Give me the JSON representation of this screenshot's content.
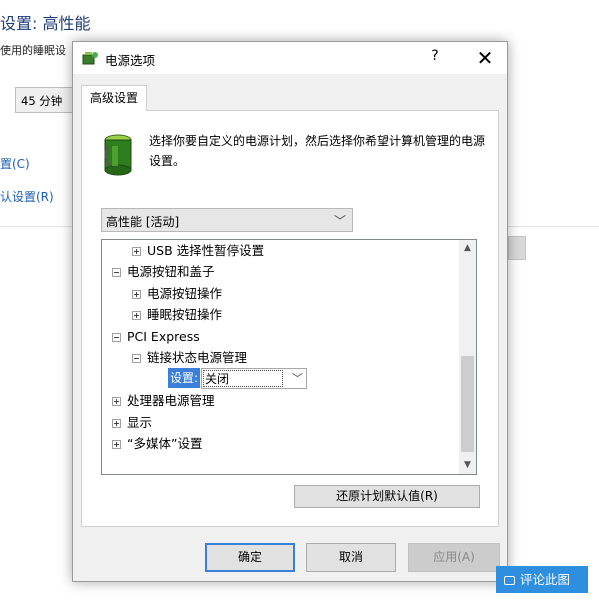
{
  "background_window": {
    "title": "设置: 高性能",
    "description": "使用的睡眠设",
    "sleep_select_value": "45 分钟",
    "link_change": "置(C)",
    "link_restore": "认设置(R)"
  },
  "dialog": {
    "title": "电源选项",
    "help": "?",
    "close": "✕",
    "tab_label": "高级设置",
    "intro_text": "选择你要自定义的电源计划，然后选择你希望计算机管理的电源设置。",
    "plan_select": "高性能 [活动]",
    "tree": [
      {
        "label": "USB 选择性暂停设置",
        "expander": "plus"
      },
      {
        "label": "电源按钮和盖子",
        "expander": "minus"
      },
      {
        "label": "电源按钮操作",
        "expander": "plus"
      },
      {
        "label": "睡眠按钮操作",
        "expander": "plus"
      },
      {
        "label": "PCI Express",
        "expander": "minus"
      },
      {
        "label": "链接状态电源管理",
        "expander": "minus"
      },
      {
        "label": "处理器电源管理",
        "expander": "plus"
      },
      {
        "label": "显示",
        "expander": "plus"
      },
      {
        "label": "“多媒体”设置",
        "expander": "plus"
      }
    ],
    "setting_label": "设置:",
    "setting_value": "关闭",
    "restore_button": "还原计划默认值(R)",
    "ok_button": "确定",
    "cancel_button": "取消",
    "apply_button": "应用(A)"
  },
  "comment_badge": "评论此图",
  "colors": {
    "accent": "#3c7fd9",
    "link": "#1a5fb4",
    "badge": "#2e8ee0"
  }
}
